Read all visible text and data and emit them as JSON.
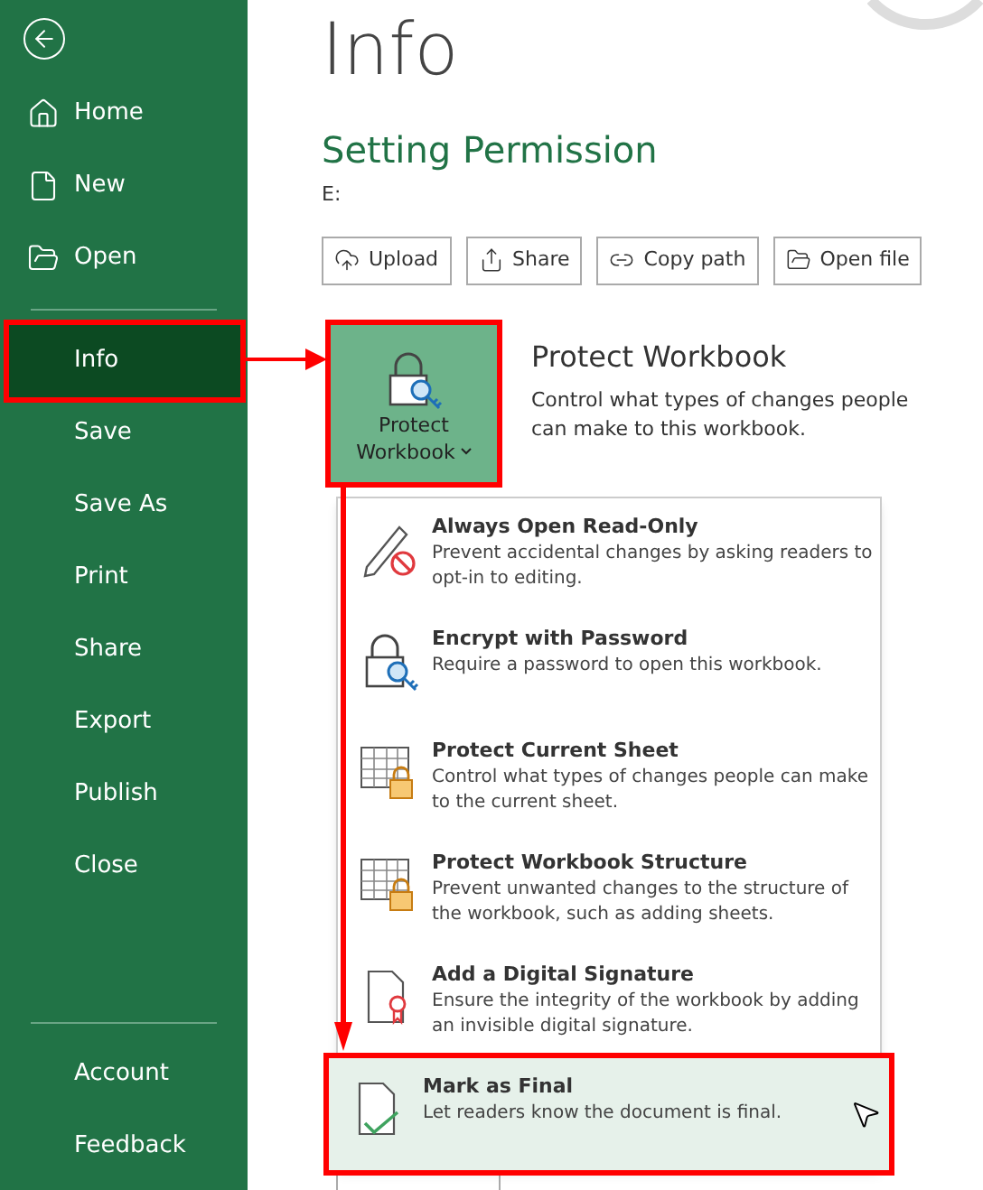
{
  "sidebar": {
    "items": [
      {
        "label": "Home",
        "selected": false,
        "annotated": false
      },
      {
        "label": "New",
        "selected": false,
        "annotated": false
      },
      {
        "label": "Open",
        "selected": false,
        "annotated": false
      },
      {
        "label": "Info",
        "selected": true,
        "annotated": true
      },
      {
        "label": "Save",
        "selected": false,
        "annotated": false
      },
      {
        "label": "Save As",
        "selected": false,
        "annotated": false
      },
      {
        "label": "Print",
        "selected": false,
        "annotated": false
      },
      {
        "label": "Share",
        "selected": false,
        "annotated": false
      },
      {
        "label": "Export",
        "selected": false,
        "annotated": false
      },
      {
        "label": "Publish",
        "selected": false,
        "annotated": false
      },
      {
        "label": "Close",
        "selected": false,
        "annotated": false
      }
    ],
    "bottom_items": [
      {
        "label": "Account",
        "selected": false
      },
      {
        "label": "Feedback",
        "selected": false
      }
    ]
  },
  "page": {
    "title": "Info",
    "document_title": "Setting Permission",
    "path": "E:"
  },
  "actions": [
    "Upload",
    "Share",
    "Copy path",
    "Open file"
  ],
  "protect": {
    "button": {
      "label_line_1": "Protect",
      "label_line_2": "Workbook",
      "annotated": true
    },
    "heading": "Protect Workbook",
    "description": "Control what types of changes people can make to this workbook."
  },
  "menu": [
    {
      "title": "Always Open Read-Only",
      "description": "Prevent accidental changes by asking readers to opt-in to editing.",
      "selected": false
    },
    {
      "title": "Encrypt with Password",
      "description": "Require a password to open this workbook.",
      "selected": false
    },
    {
      "title": "Protect Current Sheet",
      "description": "Control what types of changes people can make to the current sheet.",
      "selected": false
    },
    {
      "title": "Protect Workbook Structure",
      "description": "Prevent unwanted changes to the structure of the workbook, such as adding sheets.",
      "selected": false
    },
    {
      "title": "Add a Digital Signature",
      "description": "Ensure the integrity of the workbook by adding an invisible digital signature.",
      "selected": false
    },
    {
      "title": "Mark as Final",
      "description": "Let readers know the document is final.",
      "selected": true
    }
  ]
}
